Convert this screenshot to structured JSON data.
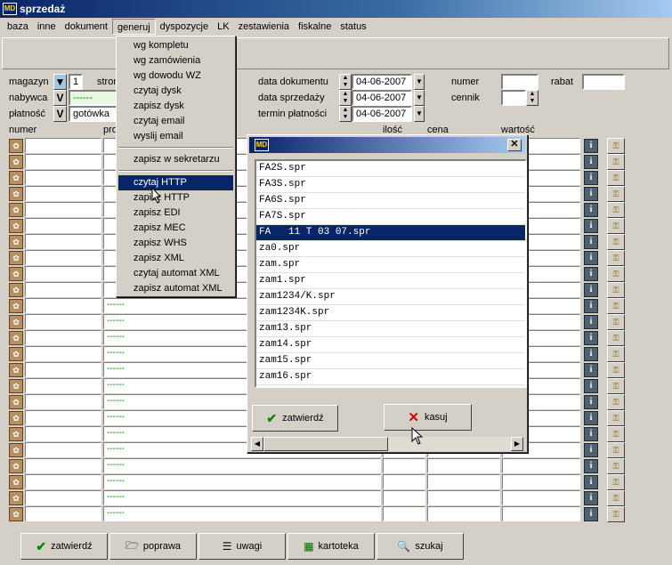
{
  "window": {
    "title": "sprzedaż",
    "icon_text": "MD"
  },
  "menu": [
    "baza",
    "inne",
    "dokument",
    "generuj",
    "dyspozycje",
    "LK",
    "zestawienia",
    "fiskalne",
    "status"
  ],
  "form": {
    "magazyn_label": "magazyn",
    "magazyn_value": "1",
    "strona_label": "stron",
    "nabywca_label": "nabywca",
    "nabywca_value": "------",
    "platnosc_label": "płatność",
    "platnosc_value": "gotówka",
    "data_dokumentu_label": "data dokumentu",
    "data_dokumentu_value": "04-06-2007",
    "data_sprzedazy_label": "data sprzedaży",
    "data_sprzedazy_value": "04-06-2007",
    "termin_label": "termin płatności",
    "termin_value": "04-06-2007",
    "numer_label": "numer",
    "numer_value": "",
    "rabat_label": "rabat",
    "rabat_value": "",
    "cennik_label": "cennik",
    "cennik_value": ""
  },
  "grid": {
    "headers": {
      "numer": "numer",
      "produkt": "pro",
      "ilosc": "ilość",
      "cena": "cena",
      "wartosc": "wartość"
    },
    "placeholder": "------",
    "info_glyph": "i"
  },
  "dropdown": {
    "group1": [
      "wg kompletu",
      "wg zamówienia",
      "wg dowodu WZ",
      "czytaj dysk",
      "zapisz dysk",
      "czytaj email",
      "wyslij email"
    ],
    "group2": [
      "zapisz w sekretarzu"
    ],
    "group3": [
      "czytaj HTTP",
      "zapisz HTTP",
      "zapisz EDI",
      "zapisz MEC",
      "zapisz WHS",
      "zapisz XML",
      "czytaj automat XML",
      "zapisz automat XML"
    ],
    "selected": "czytaj HTTP"
  },
  "dialog": {
    "icon_text": "MD",
    "close_glyph": "✕",
    "files": [
      "FA2S.spr",
      "FA3S.spr",
      "FA6S.spr",
      "FA7S.spr",
      "FA   11 T 03 07.spr",
      "za0.spr",
      "zam.spr",
      "zam1.spr",
      "zam1234/K.spr",
      "zam1234K.spr",
      "zam13.spr",
      "zam14.spr",
      "zam15.spr",
      "zam16.spr"
    ],
    "selected_file": "FA   11 T 03 07.spr",
    "confirm_label": "zatwierdź",
    "delete_label": "kasuj"
  },
  "bottom_buttons": [
    "zatwierdź",
    "poprawa",
    "uwagi",
    "kartoteka",
    "szukaj"
  ],
  "colors": {
    "title_start": "#0a246a",
    "title_end": "#a6caf0",
    "selection": "#0a246a",
    "face": "#d4d0c8"
  }
}
